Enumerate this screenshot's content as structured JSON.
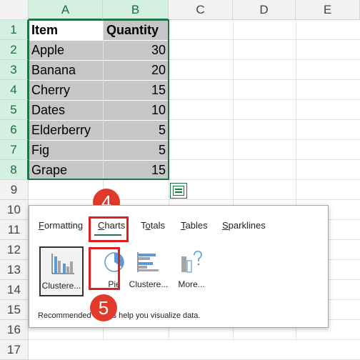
{
  "columns": [
    "A",
    "B",
    "C",
    "D",
    "E"
  ],
  "rows": [
    "1",
    "2",
    "3",
    "4",
    "5",
    "6",
    "7",
    "8",
    "9",
    "10",
    "11",
    "12",
    "13",
    "14",
    "15",
    "16",
    "17"
  ],
  "table": {
    "headers": [
      "Item",
      "Quantity"
    ],
    "data": [
      {
        "item": "Apple",
        "qty": "30"
      },
      {
        "item": "Banana",
        "qty": "20"
      },
      {
        "item": "Cherry",
        "qty": "15"
      },
      {
        "item": "Dates",
        "qty": "10"
      },
      {
        "item": "Elderberry",
        "qty": "5"
      },
      {
        "item": "Fig",
        "qty": "5"
      },
      {
        "item": "Grape",
        "qty": "15"
      }
    ]
  },
  "quick_analysis": {
    "tabs": [
      {
        "label": "Formatting",
        "underline": "F"
      },
      {
        "label": "Charts",
        "underline": "C"
      },
      {
        "label": "Totals",
        "underline": "o"
      },
      {
        "label": "Tables",
        "underline": "T"
      },
      {
        "label": "Sparklines",
        "underline": "S"
      }
    ],
    "active_tab": "Charts",
    "tiles": [
      "Clustere...",
      "Pie",
      "Clustere...",
      "More..."
    ],
    "footer": "Recommended Charts help you visualize data."
  },
  "annotations": {
    "step4": "4",
    "step5": "5"
  },
  "colors": {
    "accent": "#217346",
    "highlight_red": "#e02020",
    "badge": "#e23a2a"
  }
}
